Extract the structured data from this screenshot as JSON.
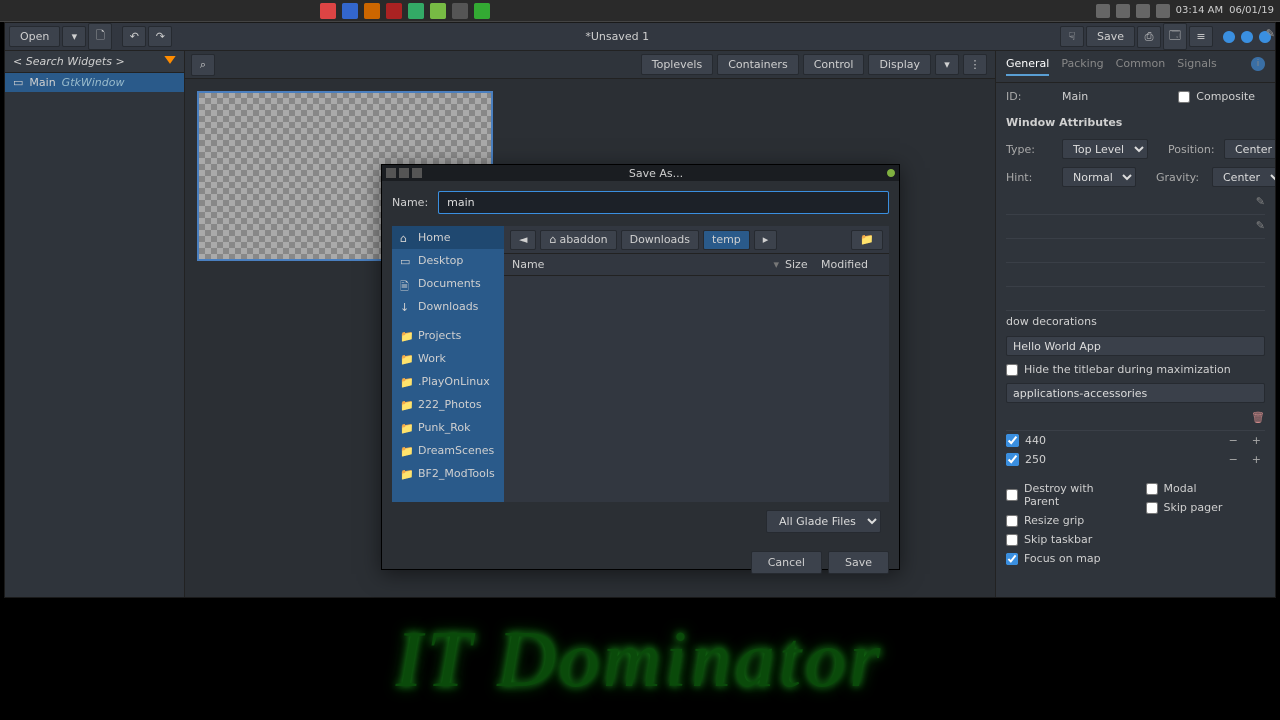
{
  "taskbar": {
    "time": "03:14 AM",
    "date": "06/01/19"
  },
  "app": {
    "open": "Open",
    "title": "*Unsaved 1",
    "save": "Save"
  },
  "left": {
    "search_placeholder": "< Search Widgets >",
    "tree": {
      "main": "Main",
      "class": "GtkWindow"
    }
  },
  "center": {
    "tabs": [
      "Toplevels",
      "Containers",
      "Control",
      "Display"
    ]
  },
  "props": {
    "tabs": [
      "General",
      "Packing",
      "Common",
      "Signals"
    ],
    "id_label": "ID:",
    "id_val": "Main",
    "composite": "Composite",
    "section": "Window Attributes",
    "type_l": "Type:",
    "type_v": "Top Level",
    "pos_l": "Position:",
    "pos_v": "Center",
    "hint_l": "Hint:",
    "hint_v": "Normal",
    "grav_l": "Gravity:",
    "grav_v": "Center",
    "deco": "dow decorations",
    "title_v": "Hello World App",
    "hide_title": "Hide the titlebar during maximization",
    "icon_v": "applications-accessories",
    "w_v": "440",
    "h_v": "250",
    "cbs": {
      "destroy": "Destroy with Parent",
      "modal": "Modal",
      "resize": "Resize grip",
      "skipp": "Skip pager",
      "skipt": "Skip taskbar",
      "focus": "Focus on map"
    }
  },
  "dialog": {
    "title": "Save As...",
    "name_l": "Name:",
    "name_v": "main",
    "places": [
      "Home",
      "Desktop",
      "Documents",
      "Downloads",
      "Projects",
      "Work",
      ".PlayOnLinux",
      "222_Photos",
      "Punk_Rok",
      "DreamScenes",
      "BF2_ModTools"
    ],
    "crumbs": [
      "abaddon",
      "Downloads",
      "temp"
    ],
    "cols": {
      "name": "Name",
      "size": "Size",
      "mod": "Modified"
    },
    "filter": "All Glade Files",
    "cancel": "Cancel",
    "save": "Save"
  },
  "watermark": "IT  Dominator"
}
